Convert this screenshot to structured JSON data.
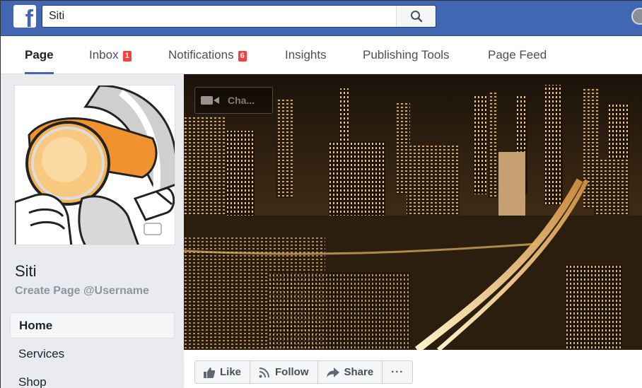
{
  "topbar": {
    "logo_letter": "f",
    "search": {
      "value": "Siti"
    }
  },
  "tabs": [
    {
      "label": "Page",
      "active": true
    },
    {
      "label": "Inbox",
      "badge": "1"
    },
    {
      "label": "Notifications",
      "badge": "6"
    },
    {
      "label": "Insights"
    },
    {
      "label": "Publishing Tools"
    },
    {
      "label": "Page Feed"
    }
  ],
  "sidebar": {
    "page_name": "Siti",
    "username_link": "Create Page @Username",
    "nav": [
      {
        "label": "Home",
        "active": true
      },
      {
        "label": "Services"
      },
      {
        "label": "Shop"
      }
    ]
  },
  "cover": {
    "change_cover_label": "Cha..."
  },
  "actions": {
    "like": "Like",
    "follow": "Follow",
    "share": "Share",
    "more": "···"
  },
  "colors": {
    "brand": "#4267b2",
    "badge": "#fa3e3e",
    "sidebar_bg": "#e9ebee"
  }
}
